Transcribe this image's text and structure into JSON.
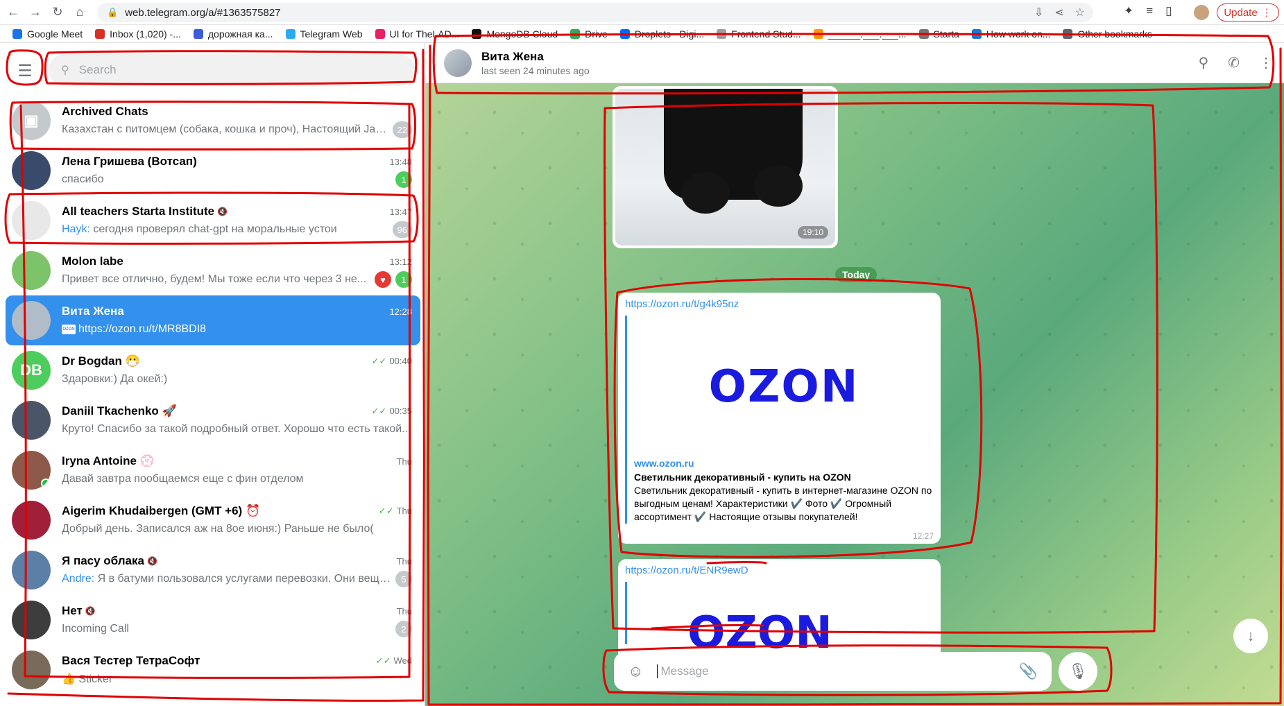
{
  "browser": {
    "url": "web.telegram.org/a/#1363575827",
    "update_label": "Update",
    "bookmarks": [
      {
        "label": "Google Meet",
        "color": "#1a73e8"
      },
      {
        "label": "Inbox (1,020) -...",
        "color": "#d93025"
      },
      {
        "label": "дорожная ка...",
        "color": "#3b5bdb"
      },
      {
        "label": "Telegram Web",
        "color": "#2aabee"
      },
      {
        "label": "UI for TheLAD...",
        "color": "#e91e63"
      },
      {
        "label": "MongoDB Cloud",
        "color": "#111"
      },
      {
        "label": "Drive",
        "color": "#34a853"
      },
      {
        "label": "Droplets - Digi...",
        "color": "#0069ff"
      },
      {
        "label": "Frontend Stud...",
        "color": "#9e9e9e"
      },
      {
        "label": "______.___.___...",
        "color": "#ff9800"
      },
      {
        "label": "Starta",
        "color": "#757575"
      },
      {
        "label": "How work on...",
        "color": "#1976d2"
      },
      {
        "label": "Other bookmarks",
        "color": "#5f6368"
      }
    ]
  },
  "sidebar": {
    "search_placeholder": "Search",
    "chats": [
      {
        "title": "Archived Chats",
        "preview": "Казахстан с питомцем (собака, кошка и проч), Настоящий Jav...",
        "time": "",
        "badge": "22",
        "badge_style": "grey",
        "avatar_color": "#c4c9cc",
        "avatar_text": ""
      },
      {
        "title": "Лена Гришева (Вотсап)",
        "preview": "спасибо",
        "time": "13:48",
        "badge": "1",
        "badge_style": "green",
        "avatar_color": "#3a4a6b",
        "avatar_text": ""
      },
      {
        "title": "All teachers Starta Institute",
        "sender": "Hayk:",
        "preview": "сегодня проверял chat-gpt на моральные устои",
        "time": "13:47",
        "badge": "96",
        "badge_style": "grey",
        "muted": true,
        "avatar_color": "#e8e8e8",
        "avatar_text": ""
      },
      {
        "title": "Molon labe",
        "preview": "Привет все отлично, будем! Мы тоже если что через 3 не...",
        "time": "13:12",
        "badge": "1",
        "badge_style": "green",
        "heart": true,
        "avatar_color": "#7cc36a",
        "avatar_text": ""
      },
      {
        "title": "Вита Жена",
        "preview": "https://ozon.ru/t/MR8BDI8",
        "time": "12:28",
        "badge": "",
        "active": true,
        "avatar_color": "#b0bcc8",
        "avatar_text": ""
      },
      {
        "title": "Dr Bogdan 😷",
        "preview": "Здаровки:) Да окей:)",
        "time": "00:40",
        "badge": "",
        "read": true,
        "avatar_color": "#4dcd5e",
        "avatar_text": "DB"
      },
      {
        "title": "Daniil Tkachenko 🚀",
        "preview": "Круто! Спасибо за такой подробный ответ. Хорошо что есть такой...",
        "time": "00:35",
        "badge": "",
        "read": true,
        "avatar_color": "#4a5568",
        "avatar_text": ""
      },
      {
        "title": "Iryna Antoine 💮",
        "preview": "Давай завтра пообщаемся еще с фин отделом",
        "time": "Thu",
        "badge": "",
        "online": true,
        "avatar_color": "#8d5a4a",
        "avatar_text": ""
      },
      {
        "title": "Aigerim Khudaibergen (GMT +6) ⏰",
        "preview": "Добрый день. Записался аж на 8ое июня:) Раньше не было(",
        "time": "Thu",
        "badge": "",
        "read": true,
        "avatar_color": "#a0203a",
        "avatar_text": ""
      },
      {
        "title": "Я пасу облака",
        "sender": "Andre:",
        "preview": "Я в батуми пользовался услугами перевозки. Они вещи...",
        "time": "Thu",
        "badge": "5",
        "badge_style": "grey",
        "muted": true,
        "avatar_color": "#5b7fa6",
        "avatar_text": ""
      },
      {
        "title": "Нет",
        "preview": "Incoming Call",
        "time": "Thu",
        "badge": "2",
        "badge_style": "grey",
        "muted": true,
        "avatar_color": "#3d3d3d",
        "avatar_text": ""
      },
      {
        "title": "Вася Тестер ТетраСофт",
        "preview": "👍 Sticker",
        "time": "Wed",
        "badge": "",
        "read": true,
        "avatar_color": "#7a6a5a",
        "avatar_text": ""
      }
    ]
  },
  "chat": {
    "name": "Вита Жена",
    "status": "last seen 24 minutes ago",
    "photo_time": "19:10",
    "date_separator": "Today",
    "link1": {
      "url": "https://ozon.ru/t/g4k95nz",
      "logo_text": "OZON",
      "site": "www.ozon.ru",
      "title": "Светильник декоративный - купить на OZON",
      "description": "Светильник декоративный - купить в интернет-магазине OZON по выгодным ценам! Характеристики ✔️ Фото ✔️ Огромный ассортимент ✔️ Настоящие отзывы покупателей!",
      "time": "12:27"
    },
    "link2": {
      "url": "https://ozon.ru/t/ENR9ewD",
      "logo_text": "OZON"
    },
    "composer_placeholder": "Message"
  }
}
